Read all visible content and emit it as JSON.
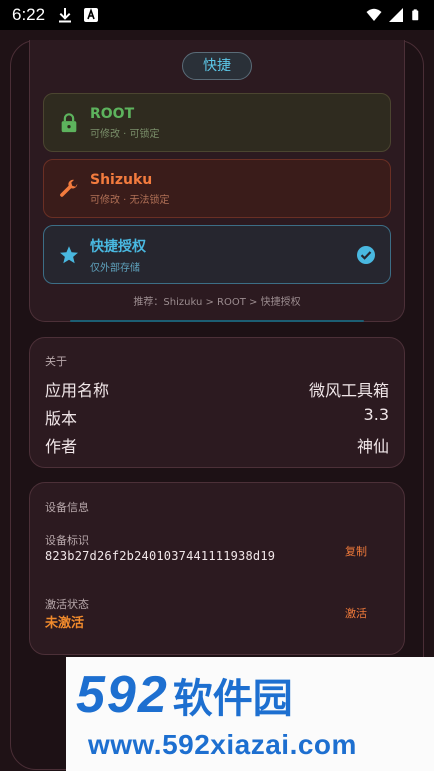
{
  "status_bar": {
    "time": "6:22",
    "left_icons": [
      "download-icon",
      "a-badge-icon"
    ],
    "right_icons": [
      "wifi-icon",
      "signal-icon",
      "battery-icon"
    ]
  },
  "auth": {
    "pill_label": "快捷",
    "options": [
      {
        "title": "ROOT",
        "subtitle": "可修改 · 可锁定",
        "icon": "lock-icon"
      },
      {
        "title": "Shizuku",
        "subtitle": "可修改 · 无法锁定",
        "icon": "wrench-icon"
      },
      {
        "title": "快捷授权",
        "subtitle": "仅外部存储",
        "icon": "star-icon",
        "selected": true
      }
    ],
    "recommend": "推荐：Shizuku > ROOT > 快捷授权"
  },
  "about": {
    "label": "关于",
    "rows": [
      {
        "key": "应用名称",
        "value": "微风工具箱"
      },
      {
        "key": "版本",
        "value": "3.3"
      },
      {
        "key": "作者",
        "value": "神仙"
      }
    ]
  },
  "device": {
    "label": "设备信息",
    "id_label": "设备标识",
    "id_value": "823b27d26f2b2401037441111938d19",
    "copy_label": "复制",
    "status_label": "激活状态",
    "status_value": "未激活",
    "activate_label": "激活"
  },
  "watermark": {
    "number": "592",
    "name": "软件园",
    "url": "www.592xiazai.com"
  },
  "colors": {
    "background": "#1f1216",
    "card": "#2c1a20",
    "root_green": "#5db35d",
    "shizuku_orange": "#f27b3e",
    "quick_blue": "#49b8e0",
    "watermark_blue": "#1d6fd0"
  }
}
